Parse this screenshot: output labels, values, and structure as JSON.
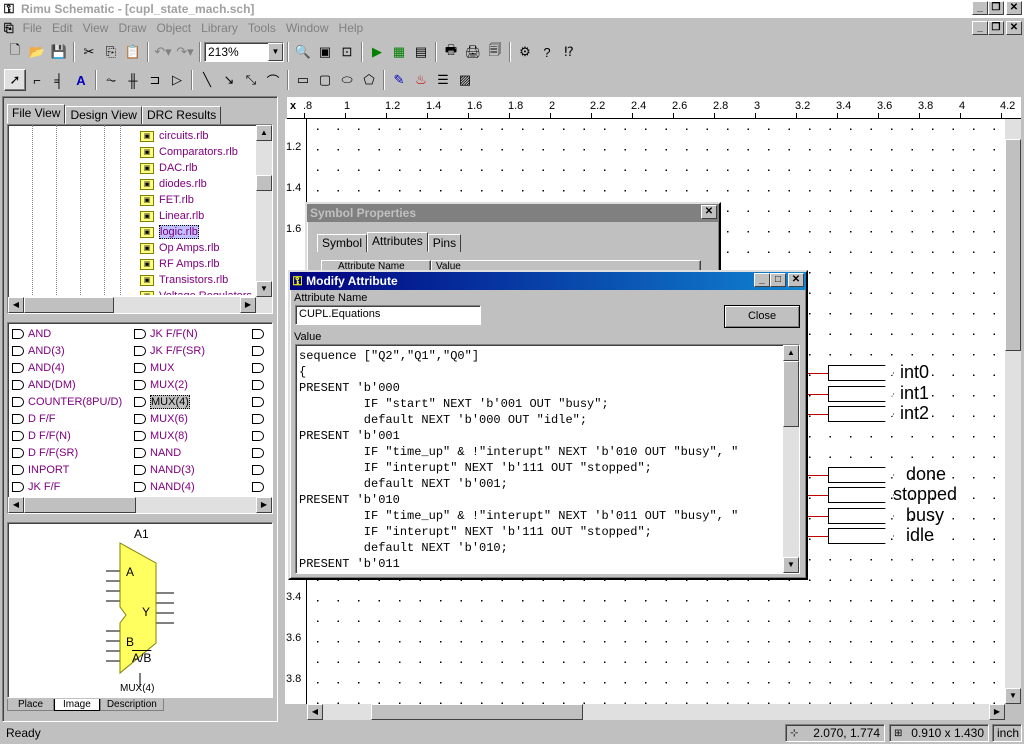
{
  "window": {
    "title": "Rimu Schematic - [cupl_state_mach.sch]"
  },
  "menu": [
    "File",
    "Edit",
    "View",
    "Draw",
    "Object",
    "Library",
    "Tools",
    "Window",
    "Help"
  ],
  "toolbar": {
    "zoom": "213%"
  },
  "left_panel": {
    "tabs": [
      "File View",
      "Design View",
      "DRC Results"
    ],
    "libraries": [
      "circuits.rlb",
      "Comparators.rlb",
      "DAC.rlb",
      "diodes.rlb",
      "FET.rlb",
      "Linear.rlb",
      "logic.rlb",
      "Op Amps.rlb",
      "RF Amps.rlb",
      "Transistors.rlb",
      "Voltage Regulators"
    ],
    "selected_library": "logic.rlb",
    "parts_col1": [
      "AND",
      "AND(3)",
      "AND(4)",
      "AND(DM)",
      "COUNTER(8PU/D)",
      "D F/F",
      "D F/F(N)",
      "D F/F(SR)",
      "INPORT",
      "JK F/F"
    ],
    "parts_col2": [
      "JK F/F(N)",
      "JK F/F(SR)",
      "MUX",
      "MUX(2)",
      "MUX(4)",
      "MUX(6)",
      "MUX(8)",
      "NAND",
      "NAND(3)",
      "NAND(4)"
    ],
    "selected_part": "MUX(4)",
    "preview": {
      "ref": "A1",
      "pin_a": "A",
      "pin_b": "B",
      "pin_y": "Y",
      "pin_ab": "A/B",
      "part_name": "MUX(4)"
    },
    "bottom_tabs": [
      "Place",
      "Image",
      "Description"
    ]
  },
  "ruler": {
    "h_ticks": [
      ".8",
      "1",
      "1.2",
      "1.4",
      "1.6",
      "1.8",
      "2",
      "2.2",
      "2.4",
      "2.6",
      "2.8",
      "3",
      "3.2",
      "3.4",
      "3.6",
      "3.8",
      "4",
      "4.2"
    ],
    "v_ticks": [
      "1.2",
      "1.4",
      "1.6",
      "3.4",
      "3.6",
      "3.8"
    ]
  },
  "symbol_props": {
    "title": "Symbol Properties",
    "tabs": [
      "Symbol",
      "Attributes",
      "Pins"
    ],
    "col_headers": [
      "Attribute Name",
      "Value"
    ]
  },
  "modify_attr": {
    "title": "Modify Attribute",
    "name_label": "Attribute Name",
    "name_value": "CUPL.Equations",
    "close_label": "Close",
    "value_label": "Value",
    "code": [
      "sequence [\"Q2\",\"Q1\",\"Q0\"]",
      "{",
      "PRESENT 'b'000",
      "         IF \"start\" NEXT 'b'001 OUT \"busy\";",
      "         default NEXT 'b'000 OUT \"idle\";",
      "PRESENT 'b'001",
      "         IF \"time_up\" & !\"interupt\" NEXT 'b'010 OUT \"busy\", \"",
      "         IF \"interupt\" NEXT 'b'111 OUT \"stopped\";",
      "         default NEXT 'b'001;",
      "PRESENT 'b'010",
      "         IF \"time_up\" & !\"interupt\" NEXT 'b'011 OUT \"busy\", \"",
      "         IF \"interupt\" NEXT 'b'111 OUT \"stopped\";",
      "         default NEXT 'b'010;",
      "PRESENT 'b'011"
    ]
  },
  "ports": [
    "int0",
    "int1",
    "int2",
    "done",
    "stopped",
    "busy",
    "idle"
  ],
  "status": {
    "text": "Ready",
    "coords": "2.070, 1.774",
    "size": "0.910 x 1.430",
    "unit": "inch"
  }
}
